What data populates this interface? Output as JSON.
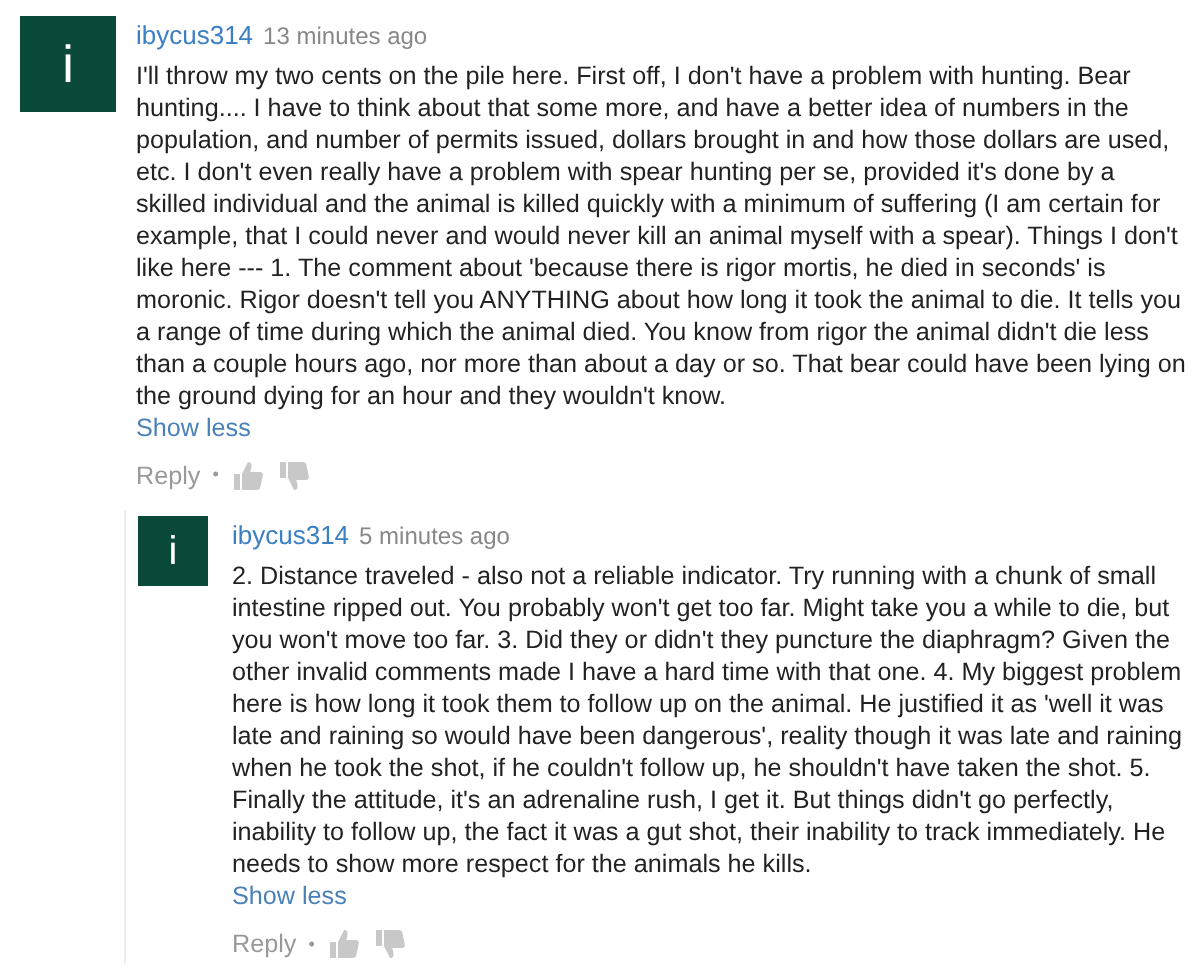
{
  "comments": [
    {
      "author": "ibycus314",
      "time": "13 minutes ago",
      "avatar_letter": "i",
      "text": "I'll throw my two cents on the pile here. First off, I don't have a problem with hunting. Bear hunting.... I have to think about that some more, and have a better idea of numbers in the population, and number of permits issued, dollars brought in and how those dollars are used, etc. I don't even really have a problem with spear hunting per se, provided it's done by a skilled individual and the animal is killed quickly with a minimum of suffering (I am certain for example, that I could never and would never kill an animal myself with a spear). Things I don't like here --- 1. The comment about 'because there is rigor mortis, he died in seconds' is moronic. Rigor doesn't tell you ANYTHING about how long it took the animal to die. It tells you a range of time during which the animal died. You know from rigor the animal didn't die less than a couple hours ago, nor more than about a day or so. That bear could have been lying on the ground dying for an hour and they wouldn't know.",
      "toggle": "Show less",
      "reply_label": "Reply",
      "separator": "•",
      "replies": [
        {
          "author": "ibycus314",
          "time": "5 minutes ago",
          "avatar_letter": "i",
          "text": "2. Distance traveled - also not a reliable indicator. Try running with a chunk of small intestine ripped out. You probably won't get too far. Might take you a while to die, but you won't move too far. 3. Did they or didn't they puncture the diaphragm? Given the other invalid comments made I have a hard time with that one. 4. My biggest problem here is how long it took them to follow up on the animal. He justified it as 'well it was late and raining so would have been dangerous',  reality though it was late and raining when he took the shot, if he couldn't follow up, he shouldn't have taken the shot. 5. Finally the attitude, it's an adrenaline rush, I get it. But things didn't go perfectly, inability to follow up, the fact it was a gut shot, their inability to track immediately. He needs to show more respect for the animals he kills.",
          "toggle": "Show less",
          "reply_label": "Reply",
          "separator": "•"
        }
      ]
    }
  ]
}
